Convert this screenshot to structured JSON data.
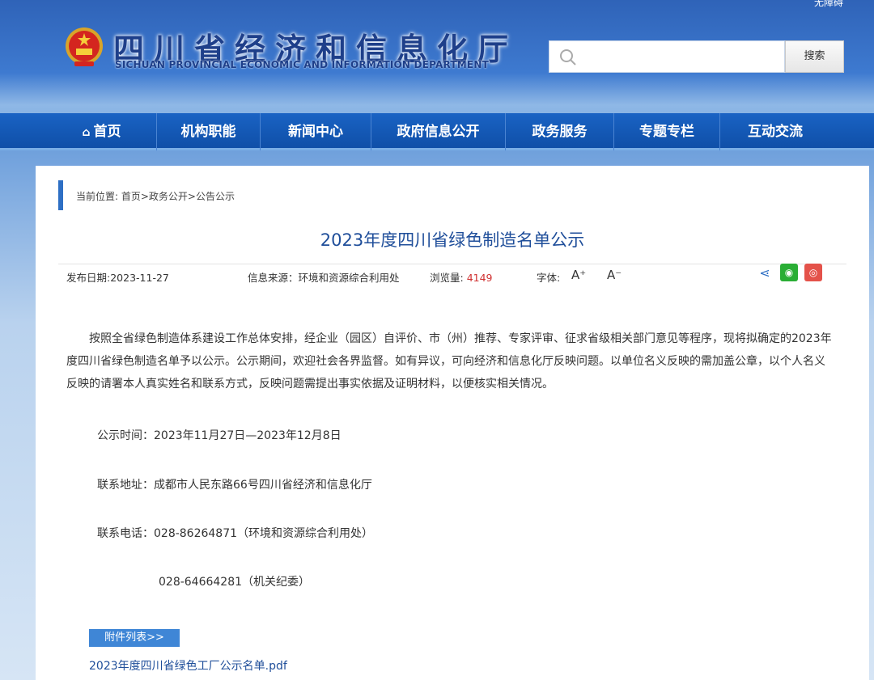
{
  "header": {
    "accessibility_link": "无障碍",
    "title": "四川省经济和信息化厅",
    "subtitle": "SICHUAN PROVINCIAL ECONOMIC AND INFORMATION DEPARTMENT",
    "search_value": "",
    "search_button": "搜索"
  },
  "nav": {
    "items": [
      {
        "label": "首页",
        "icon": "home-icon"
      },
      {
        "label": "机构职能"
      },
      {
        "label": "新闻中心"
      },
      {
        "label": "政府信息公开"
      },
      {
        "label": "政务服务"
      },
      {
        "label": "专题专栏"
      },
      {
        "label": "互动交流"
      }
    ]
  },
  "breadcrumb": "当前位置: 首页>政务公开>公告公示",
  "article": {
    "title": "2023年度四川省绿色制造名单公示",
    "publish_date": "发布日期:2023-11-27",
    "source": "信息来源：环境和资源综合利用处",
    "views_label": "浏览量: ",
    "views": "4149",
    "font_label": "字体:",
    "font_larger": "A⁺",
    "font_smaller": "A⁻",
    "body": "按照全省绿色制造体系建设工作总体安排，经企业（园区）自评价、市（州）推荐、专家评审、征求省级相关部门意见等程序，现将拟确定的2023年度四川省绿色制造名单予以公示。公示期间，欢迎社会各界监督。如有异议，可向经济和信息化厅反映问题。以单位名义反映的需加盖公章，以个人名义反映的请署本人真实姓名和联系方式，反映问题需提出事实依据及证明材料，以便核实相关情况。",
    "period": "公示时间：2023年11月27日—2023年12月8日",
    "address": "联系地址：成都市人民东路66号四川省经济和信息化厅",
    "phone1": "联系电话：028-86264871（环境和资源综合利用处）",
    "phone2": "028-64664281（机关纪委）",
    "attachments_label": "附件列表>>",
    "attachment_file": "2023年度四川省绿色工厂公示名单.pdf"
  },
  "colors": {
    "nav_bg": "#1a63c4",
    "title_blue": "#1f4e9a",
    "views_red": "#d03030",
    "wechat_green": "#2aae35",
    "weibo_red": "#e4524a"
  }
}
